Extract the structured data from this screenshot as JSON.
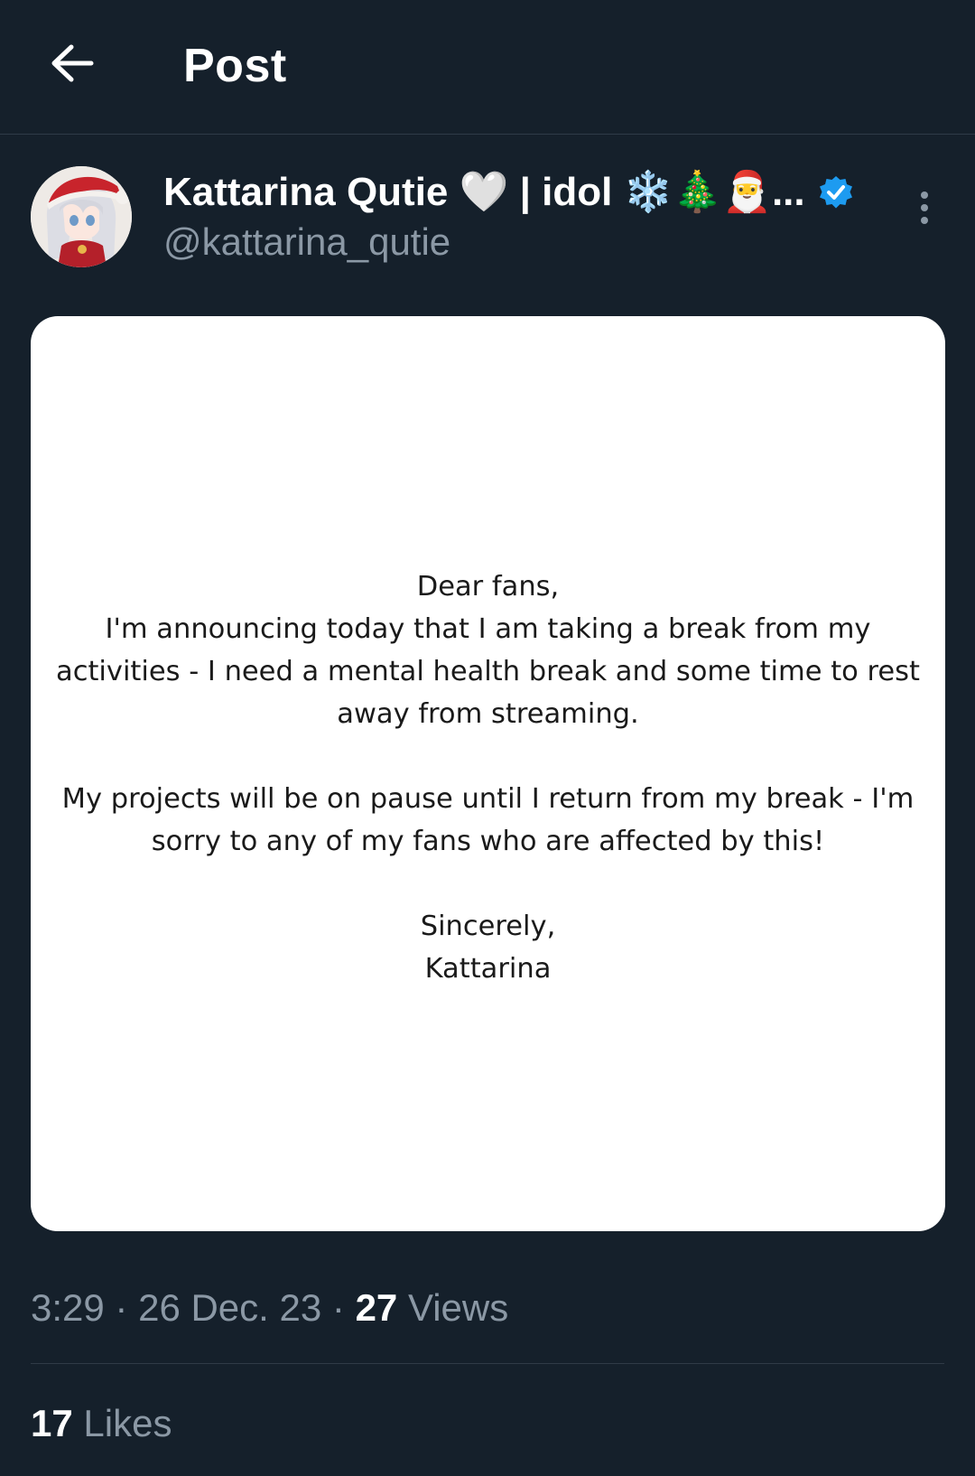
{
  "header": {
    "title": "Post",
    "back_icon": "arrow-left-icon"
  },
  "author": {
    "display_name": "Kattarina Qutie 🤍 | idol ❄️🎄🎅...",
    "handle": "@kattarina_qutie",
    "verified_icon": "verified-badge-icon",
    "verified_color": "#1d9bf0",
    "more_icon": "more-vertical-icon"
  },
  "media": {
    "letter": {
      "greeting": "Dear fans,",
      "line1": "I'm announcing today that I am taking a break from my",
      "line2": "activities - I need a mental health break and some time to rest",
      "line3": "away from streaming.",
      "line4": "My projects will be on pause until I return from my break - I'm",
      "line5": "sorry to any of my fans who are affected by this!",
      "closing": "Sincerely,",
      "signature": "Kattarina"
    }
  },
  "meta": {
    "time": "3:29",
    "date": "26 Dec. 23",
    "separator": "·",
    "views_count": "27",
    "views_label": "Views"
  },
  "stats": {
    "likes_count": "17",
    "likes_label": "Likes"
  },
  "colors": {
    "background": "#15202b",
    "secondary_text": "#8b98a5",
    "divider": "#2f3b47"
  }
}
